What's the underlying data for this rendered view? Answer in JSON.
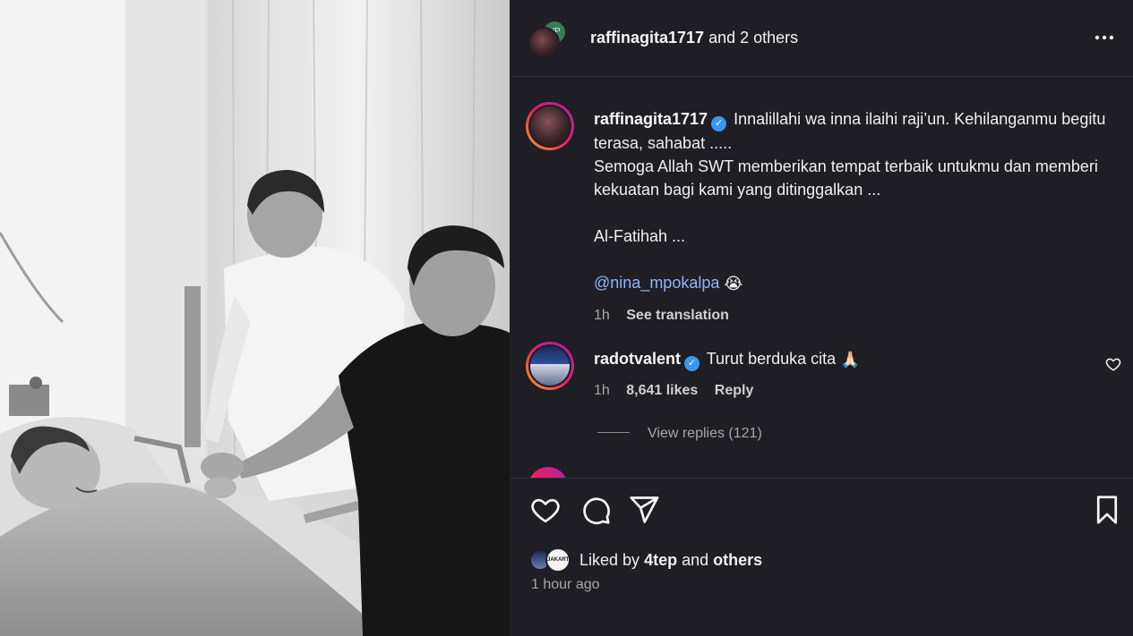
{
  "header": {
    "username": "raffinagita1717",
    "others": "and 2 others",
    "collab_badge": "VP",
    "more_icon": "more-horizontal-icon"
  },
  "caption": {
    "username": "raffinagita1717",
    "line1": "Innalillahi wa inna ilaihi raji’un. Kehilanganmu begitu terasa, sahabat .....",
    "line2": "Semoga Allah SWT memberikan tempat terbaik untukmu dan memberi kekuatan bagi kami yang ditinggalkan ...",
    "line3": "Al-Fatihah ...",
    "mention": "@nina_mpokalpa",
    "emoji": "😭",
    "time": "1h",
    "translate": "See translation"
  },
  "comment": {
    "username": "radotvalent",
    "text": "Turut berduka cita",
    "emoji": "🙏🏻",
    "time": "1h",
    "likes": "8,641 likes",
    "reply": "Reply",
    "view_replies": "View replies (121)"
  },
  "actions": {
    "like_icon": "heart-icon",
    "comment_icon": "comment-icon",
    "share_icon": "share-icon",
    "save_icon": "bookmark-icon"
  },
  "liked": {
    "prefix": "Liked by",
    "user": "4tep",
    "and": "and",
    "others": "others",
    "avatar_badge": "JAKARTA"
  },
  "post_time": "1 hour ago",
  "colors": {
    "panel_bg": "#1e1e24",
    "verified": "#3897f0",
    "mention": "#8fb5ff",
    "muted": "#a8a8a8"
  }
}
